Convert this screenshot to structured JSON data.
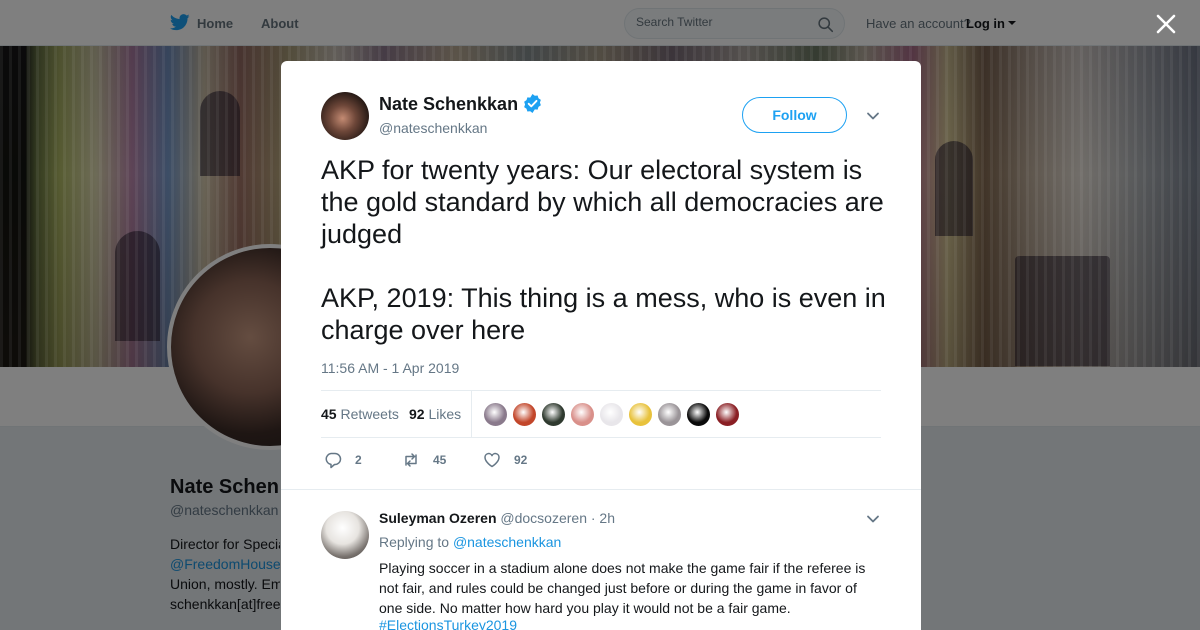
{
  "nav": {
    "home": "Home",
    "about": "About",
    "search_placeholder": "Search Twitter",
    "account_prompt": "Have an account?",
    "login": "Log in"
  },
  "profile_bg": {
    "name": "Nate Schen",
    "handle": "@nateschenkkan",
    "bio_lines": [
      "Director for Specia",
      "@FreedomHouse",
      "Union, mostly. Em",
      "schenkkan[at]free"
    ]
  },
  "tweet": {
    "author_name": "Nate Schenkkan",
    "author_handle": "@nateschenkkan",
    "follow_label": "Follow",
    "text": "AKP for twenty years: Our electoral system is the gold standard by which all democracies are judged\n\nAKP, 2019: This thing is a mess, who is even in charge over here",
    "timestamp": "11:56 AM - 1 Apr 2019",
    "retweets_count": "45",
    "retweets_label": "Retweets",
    "likes_count": "92",
    "likes_label": "Likes",
    "reply_count": "2",
    "retweet_action_count": "45",
    "like_action_count": "92"
  },
  "likers": [
    {
      "color": "#8a7a8c"
    },
    {
      "color": "#c2462a"
    },
    {
      "color": "#2f3a2f"
    },
    {
      "color": "#d9908a"
    },
    {
      "color": "#e8e6ea"
    },
    {
      "color": "#e8c23c"
    },
    {
      "color": "#9a9498"
    },
    {
      "color": "#0a0a0a"
    },
    {
      "color": "#8a1f24"
    }
  ],
  "reply": {
    "name": "Suleyman Ozeren",
    "handle": "@docsozeren",
    "time": "· 2h",
    "replying_to_label": "Replying to",
    "replying_to_handle": "@nateschenkkan",
    "text": "Playing soccer in a stadium alone does not make the game fair if the referee is not fair, and rules could be changed just before or during the game in favor of one side. No matter how hard you play it would not be a fair game.",
    "hashtag": "#ElectionsTurkey2019"
  },
  "colors": {
    "accent": "#1da1f2",
    "link": "#1b95e0",
    "muted": "#657786"
  }
}
